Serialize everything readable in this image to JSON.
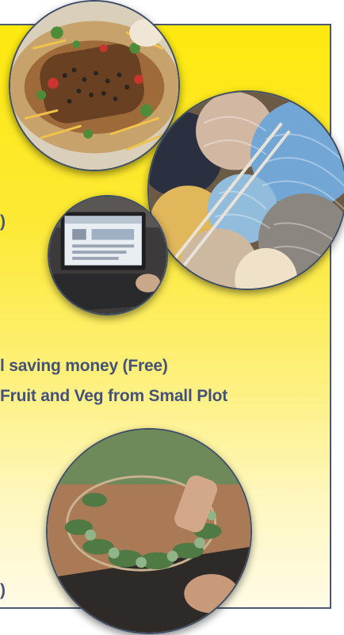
{
  "panel": {
    "accent_color": "#4a5a73",
    "background_top": "#fde90e",
    "background_bottom": "#fffbe6"
  },
  "text": {
    "line1_fragment": ")",
    "line2": "l saving money (Free)",
    "line3": "Fruit and Veg from Small Plot",
    "line4_fragment": ")"
  },
  "images": [
    {
      "name": "salad-photo"
    },
    {
      "name": "yarn-knitting-photo"
    },
    {
      "name": "laptop-photo"
    },
    {
      "name": "wreath-making-photo"
    }
  ]
}
